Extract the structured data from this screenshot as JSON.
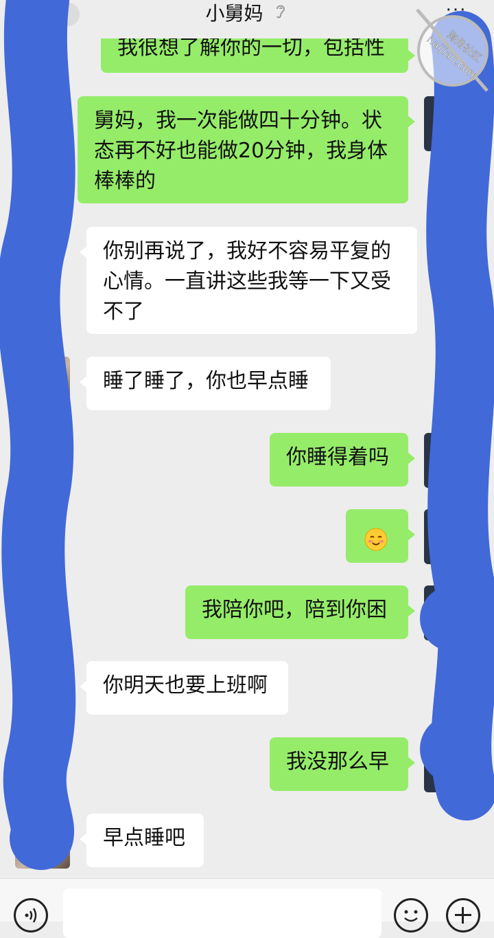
{
  "header": {
    "title": "小舅妈",
    "more_label": "···"
  },
  "messages": [
    {
      "id": "m0",
      "side": "out",
      "text": "我很想了解你的一切，包括性"
    },
    {
      "id": "m1",
      "side": "out",
      "text": "舅妈，我一次能做四十分钟。状态再不好也能做20分钟，我身体棒棒的"
    },
    {
      "id": "m2",
      "side": "in",
      "text": "你别再说了，我好不容易平复的心情。一直讲这些我等一下又受不了"
    },
    {
      "id": "m3",
      "side": "in",
      "text": "睡了睡了，你也早点睡"
    },
    {
      "id": "m4",
      "side": "out",
      "text": "你睡得着吗"
    },
    {
      "id": "m5",
      "side": "out",
      "emoji": "smiling-blush-emoji"
    },
    {
      "id": "m6",
      "side": "out",
      "text": "我陪你吧，陪到你困"
    },
    {
      "id": "m7",
      "side": "in",
      "text": "你明天也要上班啊"
    },
    {
      "id": "m8",
      "side": "out",
      "text": "我没那么早"
    },
    {
      "id": "m9",
      "side": "in",
      "text": "早点睡吧"
    }
  ],
  "input": {
    "placeholder": "",
    "value": ""
  },
  "watermark": {
    "line1": "海角社区",
    "line2": "haijiao.com"
  },
  "colors": {
    "background": "#ededed",
    "outgoing_bubble": "#95ec69",
    "incoming_bubble": "#ffffff",
    "redaction": "#4169d8"
  }
}
